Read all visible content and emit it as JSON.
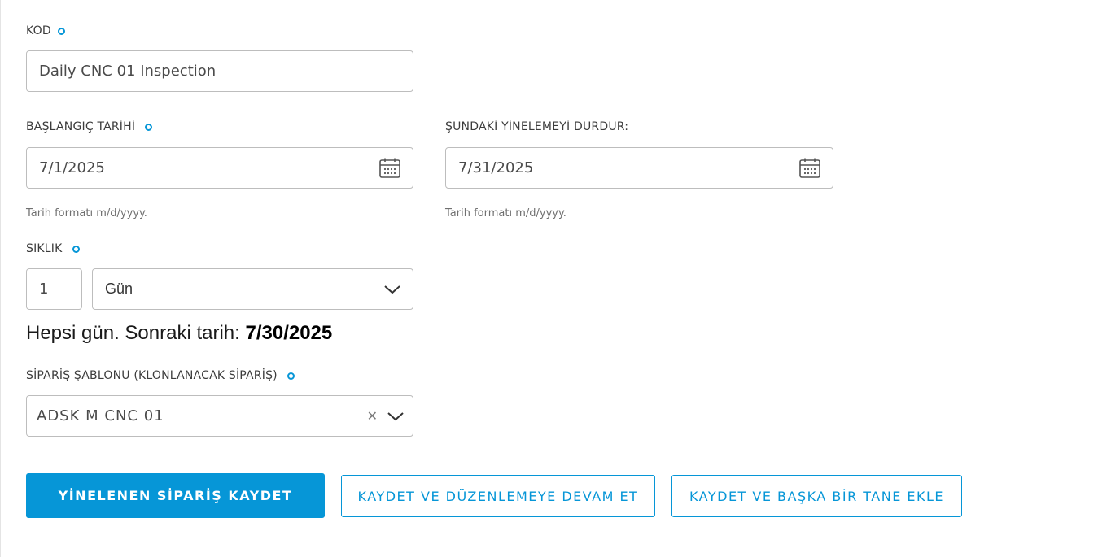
{
  "form": {
    "code": {
      "label": "KOD",
      "value": "Daily CNC 01 Inspection"
    },
    "start_date": {
      "label": "BAŞLANGIÇ TARİHİ",
      "value": "7/1/2025",
      "hint": "Tarih formatı m/d/yyyy."
    },
    "stop_date": {
      "label": "ŞUNDAKİ YİNELEMEYİ DURDUR:",
      "value": "7/31/2025",
      "hint": "Tarih formatı m/d/yyyy."
    },
    "frequency": {
      "label": "SIKLIK",
      "count": "1",
      "unit": "Gün"
    },
    "next": {
      "prefix": "Hepsi gün. Sonraki tarih: ",
      "date": "7/30/2025"
    },
    "template": {
      "label": "SİPARİŞ ŞABLONU (KLONLANACAK SİPARİŞ)",
      "value": "ADSK M CNC 01"
    }
  },
  "actions": {
    "save": "YİNELENEN SİPARİŞ KAYDET",
    "save_continue": "KAYDET VE DÜZENLEMEYE DEVAM ET",
    "save_add": "KAYDET VE BAŞKA BİR TANE EKLE"
  },
  "icons": {
    "required": "required-dot-icon",
    "calendar": "calendar-icon",
    "chevron": "chevron-down-icon",
    "clear": "clear-icon"
  },
  "colors": {
    "accent": "#0696d7",
    "border": "#bdbdbd",
    "text": "#3c3c3c"
  }
}
